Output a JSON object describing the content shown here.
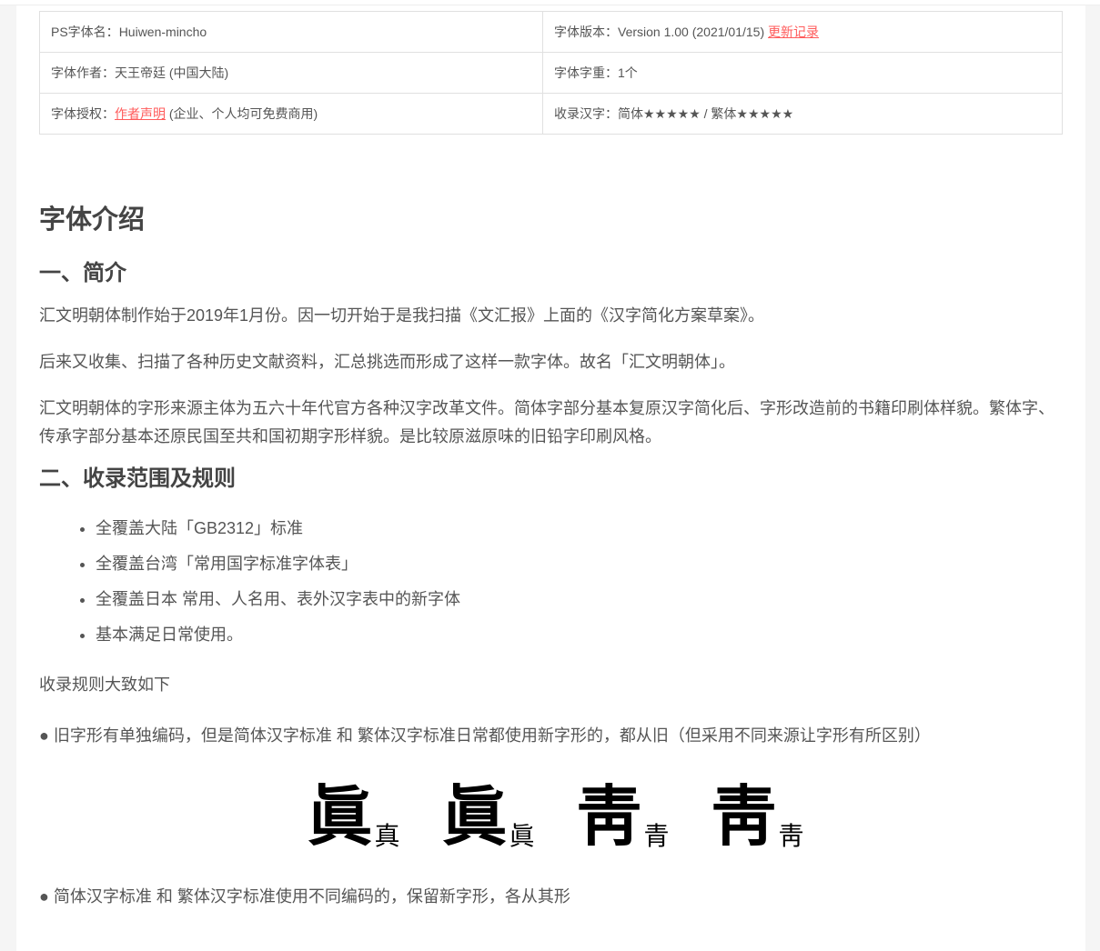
{
  "info_table": [
    [
      {
        "label": "PS字体名：",
        "value": "Huiwen-mincho"
      },
      {
        "label": "字体版本：",
        "value": "Version 1.00 (2021/01/15) ",
        "link": "更新记录"
      }
    ],
    [
      {
        "label": "字体作者：",
        "value": "天王帝廷 (中国大陆)"
      },
      {
        "label": "字体字重：",
        "value": "1个"
      }
    ],
    [
      {
        "label": "字体授权：",
        "link": "作者声明",
        "value": " (企业、个人均可免费商用)"
      },
      {
        "label": "收录汉字：",
        "value": "简体★★★★★ / 繁体★★★★★"
      }
    ]
  ],
  "title": "字体介绍",
  "section1": {
    "heading": "一、简介",
    "paragraphs": [
      "汇文明朝体制作始于2019年1月份。因一切开始于是我扫描《文汇报》上面的《汉字简化方案草案》。",
      "后来又收集、扫描了各种历史文献资料，汇总挑选而形成了这样一款字体。故名「汇文明朝体」。",
      "汇文明朝体的字形来源主体为五六十年代官方各种汉字改革文件。简体字部分基本复原汉字简化后、字形改造前的书籍印刷体样貌。繁体字、传承字部分基本还原民国至共和国初期字形样貌。是比较原滋原味的旧铅字印刷风格。"
    ]
  },
  "section2": {
    "heading": "二、收录范围及规则",
    "bullets": [
      "全覆盖大陆「GB2312」标准",
      "全覆盖台湾「常用国字标准字体表」",
      "全覆盖日本 常用、人名用、表外汉字表中的新字体",
      "基本满足日常使用。"
    ],
    "rules_intro": "收录规则大致如下",
    "rule1": "● 旧字形有单独编码，但是简体汉字标准 和 繁体汉字标准日常都使用新字形的，都从旧（但采用不同来源让字形有所区别）",
    "sample_glyphs": [
      {
        "big": "眞",
        "small": "真"
      },
      {
        "big": "眞",
        "small": "眞"
      },
      {
        "big": "靑",
        "small": "青"
      },
      {
        "big": "靑",
        "small": "靑"
      }
    ],
    "rule2": "● 简体汉字标准 和 繁体汉字标准使用不同编码的，保留新字形，各从其形"
  }
}
